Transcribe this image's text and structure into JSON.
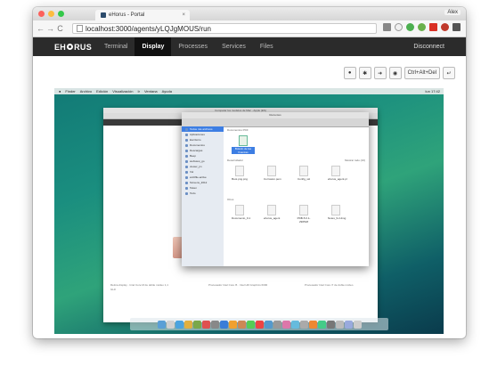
{
  "browser": {
    "tab_title": "eHorus - Portal",
    "tab_close": "×",
    "user_name": "Alex",
    "back": "←",
    "forward": "→",
    "reload": "C",
    "url": "localhost:3000/agents/yLQJgMOUS/run"
  },
  "app": {
    "logo_left": "EH",
    "logo_right": "RUS",
    "nav": [
      "Terminal",
      "Display",
      "Processes",
      "Services",
      "Files"
    ],
    "active_nav": "Display",
    "disconnect_label": "Disconnect"
  },
  "controls": {
    "ctrl_alt_del_label": "Ctrl+Alt+Del"
  },
  "remote_screen": {
    "menu_items": [
      "Finder",
      "Archivo",
      "Edición",
      "Visualización",
      "Ir",
      "Ventana",
      "Ayuda"
    ],
    "menu_clock": "lun 17:42",
    "browser_title": "Comparar los modelos de Mac - Apple (ES)",
    "finder_title": "Recientes",
    "sidebar_items": [
      "Todos mis archivos",
      "Aplicaciones",
      "Escritorio",
      "Documentos",
      "Descargas",
      "Beep",
      "webview_go",
      "viewer_jm",
      "Vol",
      "eHUfile-active",
      "Screens_2012",
      "Token",
      "Todo"
    ],
    "selected_sidebar": "Todos mis archivos",
    "sec_recent": "Documentos PDF",
    "sec_desktop": "Desarrollador",
    "sec_desktop_more": "Mostrar todo (16)",
    "sec_other": "Otros",
    "recent_file": "Boletín de las finanzas",
    "desktop_files": [
      "Boot.png.png",
      "Corrosion.pem",
      "Config_ssl",
      "ehorus_agent.pl"
    ],
    "other_files": [
      "Documento_9.1",
      "ehorus_agent",
      "PDB-5.0.1-290518",
      "Notes_9.2.dmg"
    ],
    "spec_col1": "Retina display · Intel Core M de doble núcleo 1,1 GHz",
    "spec_col2": "Procesador Intel Core i5 · Intel HD Graphics 6000",
    "spec_col3": "Procesador Intel Core i7 de doble núcleo"
  },
  "icons": {
    "secure_icon": "page-icon",
    "eye_icon": "eye-icon",
    "return_icon": "return-icon"
  },
  "colors": {
    "nav_bg": "#2b2b2b",
    "nav_active_bg": "#111111",
    "wallpaper": "#1a8e7f"
  }
}
